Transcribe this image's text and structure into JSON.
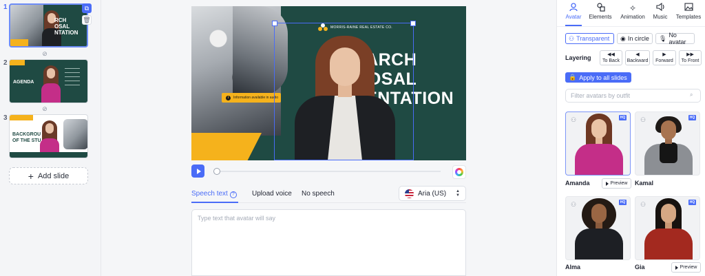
{
  "slides": [
    {
      "number": "1",
      "headline": "RCH\nOSAL\nNTATION"
    },
    {
      "number": "2",
      "headline": "AGENDA"
    },
    {
      "number": "3",
      "headline": "BACKGROU\nOF THE STU"
    }
  ],
  "add_slide_label": "Add slide",
  "canvas": {
    "company": "MORRIS-RAINE REAL ESTATE CO.",
    "headline": "RESEARCH\nPROPOSAL\nPRESENTATION",
    "info_banner": "Information available in audio"
  },
  "speech": {
    "tabs": [
      "Speech text",
      "Upload voice",
      "No speech"
    ],
    "voice": "Aria (US)",
    "placeholder": "Type text that avatar will say"
  },
  "panel": {
    "tabs": [
      {
        "label": "Avatar",
        "icon": "person-icon"
      },
      {
        "label": "Elements",
        "icon": "shapes-icon"
      },
      {
        "label": "Animation",
        "icon": "sparkle-icon"
      },
      {
        "label": "Music",
        "icon": "speaker-icon"
      },
      {
        "label": "Templates",
        "icon": "image-icon"
      }
    ],
    "modes": [
      "Transparent",
      "In circle",
      "No avatar"
    ],
    "layering_label": "Layering",
    "layering": [
      "To Back",
      "Backward",
      "Forward",
      "To Front"
    ],
    "apply_all": "Apply to all slides",
    "filter_placeholder": "Filter avatars by outfit",
    "hq_badge": "HQ",
    "preview_label": "Preview",
    "avatars": [
      "Amanda",
      "Kamal",
      "Alma",
      "Gia"
    ]
  },
  "colors": {
    "accent": "#4a6cf7",
    "slide_green": "#1f4a43",
    "slide_yellow": "#f5b21c"
  }
}
